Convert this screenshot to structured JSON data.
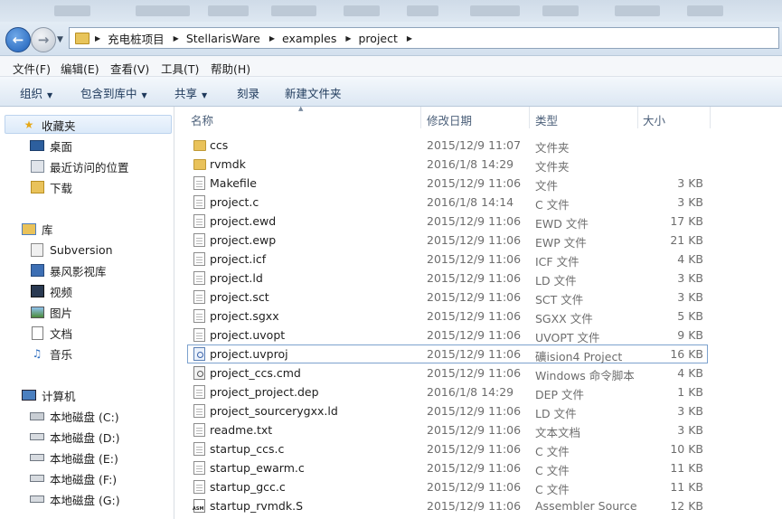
{
  "address": {
    "crumbs": [
      "充电桩项目",
      "StellarisWare",
      "examples",
      "project"
    ]
  },
  "menu": [
    "文件(F)",
    "编辑(E)",
    "查看(V)",
    "工具(T)",
    "帮助(H)"
  ],
  "toolbar": {
    "organize": "组织",
    "include_library": "包含到库中",
    "share": "共享",
    "burn": "刻录",
    "new_folder": "新建文件夹"
  },
  "nav": {
    "favorites": "收藏夹",
    "desktop": "桌面",
    "recent": "最近访问的位置",
    "downloads": "下载",
    "libraries": "库",
    "subversion": "Subversion",
    "baofeng": "暴风影视库",
    "videos": "视频",
    "pictures": "图片",
    "documents": "文档",
    "music": "音乐",
    "computer": "计算机",
    "drive_c": "本地磁盘 (C:)",
    "drive_d": "本地磁盘 (D:)",
    "drive_e": "本地磁盘 (E:)",
    "drive_f": "本地磁盘 (F:)",
    "drive_g": "本地磁盘 (G:)"
  },
  "columns": {
    "name": "名称",
    "date": "修改日期",
    "type": "类型",
    "size": "大小"
  },
  "files": [
    {
      "name": "ccs",
      "date": "2015/12/9 11:07",
      "type": "文件夹",
      "size": "",
      "icon": "folder-icon"
    },
    {
      "name": "rvmdk",
      "date": "2016/1/8 14:29",
      "type": "文件夹",
      "size": "",
      "icon": "folder-icon"
    },
    {
      "name": "Makefile",
      "date": "2015/12/9 11:06",
      "type": "文件",
      "size": "3 KB",
      "icon": "file-icon"
    },
    {
      "name": "project.c",
      "date": "2016/1/8 14:14",
      "type": "C 文件",
      "size": "3 KB",
      "icon": "file-icon"
    },
    {
      "name": "project.ewd",
      "date": "2015/12/9 11:06",
      "type": "EWD 文件",
      "size": "17 KB",
      "icon": "file-icon"
    },
    {
      "name": "project.ewp",
      "date": "2015/12/9 11:06",
      "type": "EWP 文件",
      "size": "21 KB",
      "icon": "file-icon"
    },
    {
      "name": "project.icf",
      "date": "2015/12/9 11:06",
      "type": "ICF 文件",
      "size": "4 KB",
      "icon": "file-icon"
    },
    {
      "name": "project.ld",
      "date": "2015/12/9 11:06",
      "type": "LD 文件",
      "size": "3 KB",
      "icon": "file-icon"
    },
    {
      "name": "project.sct",
      "date": "2015/12/9 11:06",
      "type": "SCT 文件",
      "size": "3 KB",
      "icon": "file-icon"
    },
    {
      "name": "project.sgxx",
      "date": "2015/12/9 11:06",
      "type": "SGXX 文件",
      "size": "5 KB",
      "icon": "file-icon"
    },
    {
      "name": "project.uvopt",
      "date": "2015/12/9 11:06",
      "type": "UVOPT 文件",
      "size": "9 KB",
      "icon": "file-icon"
    },
    {
      "name": "project.uvproj",
      "date": "2015/12/9 11:06",
      "type": "礦ision4 Project",
      "size": "16 KB",
      "icon": "uvision-icon"
    },
    {
      "name": "project_ccs.cmd",
      "date": "2015/12/9 11:06",
      "type": "Windows 命令脚本",
      "size": "4 KB",
      "icon": "cmd-icon"
    },
    {
      "name": "project_project.dep",
      "date": "2016/1/8 14:29",
      "type": "DEP 文件",
      "size": "1 KB",
      "icon": "file-icon"
    },
    {
      "name": "project_sourcerygxx.ld",
      "date": "2015/12/9 11:06",
      "type": "LD 文件",
      "size": "3 KB",
      "icon": "file-icon"
    },
    {
      "name": "readme.txt",
      "date": "2015/12/9 11:06",
      "type": "文本文档",
      "size": "3 KB",
      "icon": "text-file-icon"
    },
    {
      "name": "startup_ccs.c",
      "date": "2015/12/9 11:06",
      "type": "C 文件",
      "size": "10 KB",
      "icon": "file-icon"
    },
    {
      "name": "startup_ewarm.c",
      "date": "2015/12/9 11:06",
      "type": "C 文件",
      "size": "11 KB",
      "icon": "file-icon"
    },
    {
      "name": "startup_gcc.c",
      "date": "2015/12/9 11:06",
      "type": "C 文件",
      "size": "11 KB",
      "icon": "file-icon"
    },
    {
      "name": "startup_rvmdk.S",
      "date": "2015/12/9 11:06",
      "type": "Assembler Source",
      "size": "12 KB",
      "icon": "asm-file-icon"
    }
  ]
}
